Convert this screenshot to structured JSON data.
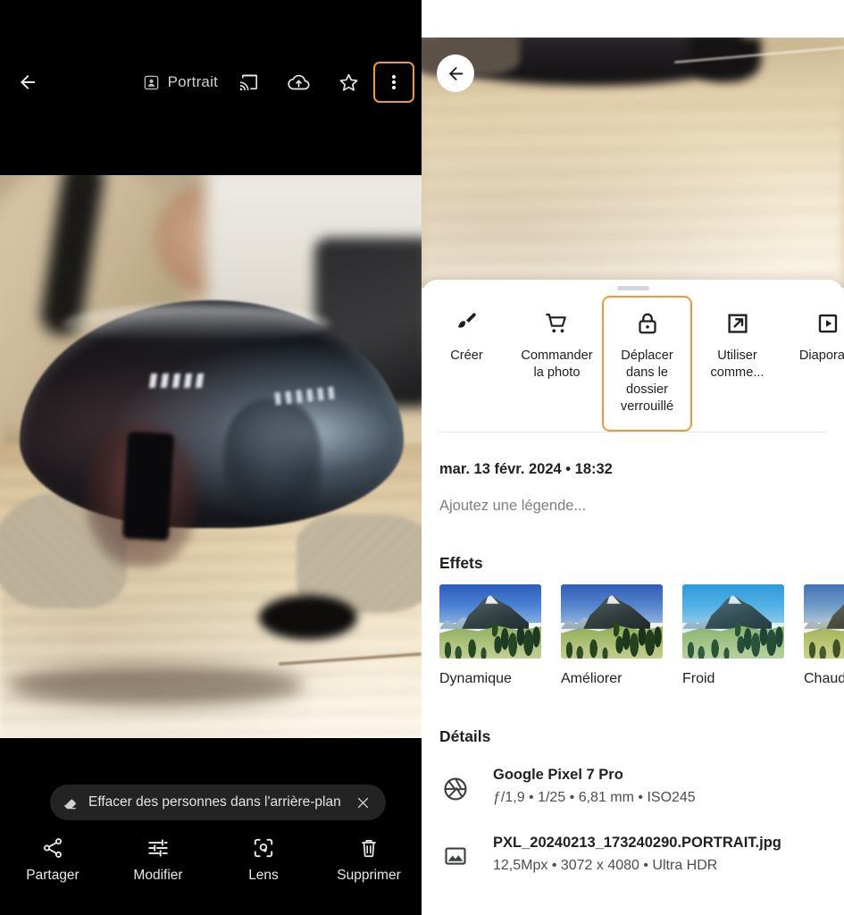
{
  "accent": {
    "highlight_orange": "#f09838",
    "toolbar_bg": "#000000",
    "sheet_bg": "#ffffff"
  },
  "left_panel": {
    "toolbar": {
      "back_label": "Retour",
      "mode_label": "Portrait",
      "icons": {
        "portrait": "portrait-icon",
        "cast": "cast-icon",
        "cloud_upload": "cloud-upload-icon",
        "favorite": "star-icon",
        "overflow": "more-vert-icon"
      }
    },
    "photo": {
      "alt": "Casque Apple Vision Pro posé sur une table en bois"
    },
    "suggestion_chip": {
      "icon": "eraser-icon",
      "label": "Effacer des personnes dans l'arrière-plan",
      "close_icon": "close-icon"
    },
    "actions": [
      {
        "icon": "share-icon",
        "label": "Partager"
      },
      {
        "icon": "tune-icon",
        "label": "Modifier"
      },
      {
        "icon": "lens-icon",
        "label": "Lens"
      },
      {
        "icon": "trash-icon",
        "label": "Supprimer"
      }
    ]
  },
  "right_panel": {
    "back_button": {
      "icon": "arrow-back-icon",
      "label": "Retour"
    },
    "sheet": {
      "handle": "drag-handle",
      "actions": [
        {
          "icon": "brush-icon",
          "label": "Créer",
          "selected": false
        },
        {
          "icon": "cart-icon",
          "label": "Commander\nla photo",
          "selected": false
        },
        {
          "icon": "lock-icon",
          "label": "Déplacer\ndans le\ndossier\nverrouillé",
          "selected": true
        },
        {
          "icon": "open-in-new-icon",
          "label": "Utiliser\ncomme...",
          "selected": false
        },
        {
          "icon": "slideshow-icon",
          "label": "Diaporam",
          "selected": false
        }
      ],
      "date": "mar. 13 févr. 2024  •  18:32",
      "caption_placeholder": "Ajoutez une légende...",
      "effects_title": "Effets",
      "effects": [
        {
          "label": "Dynamique"
        },
        {
          "label": "Améliorer"
        },
        {
          "label": "Froid"
        },
        {
          "label": "Chaud"
        }
      ],
      "details_title": "Détails",
      "details": [
        {
          "icon": "aperture-icon",
          "primary": "Google Pixel 7 Pro",
          "secondary": "ƒ/1,9  •  1/25  •  6,81 mm  •  ISO245"
        },
        {
          "icon": "image-icon",
          "primary": "PXL_20240213_173240290.PORTRAIT.jpg",
          "secondary": "12,5Mpx  •  3072 x 4080  •  Ultra HDR"
        }
      ]
    }
  }
}
